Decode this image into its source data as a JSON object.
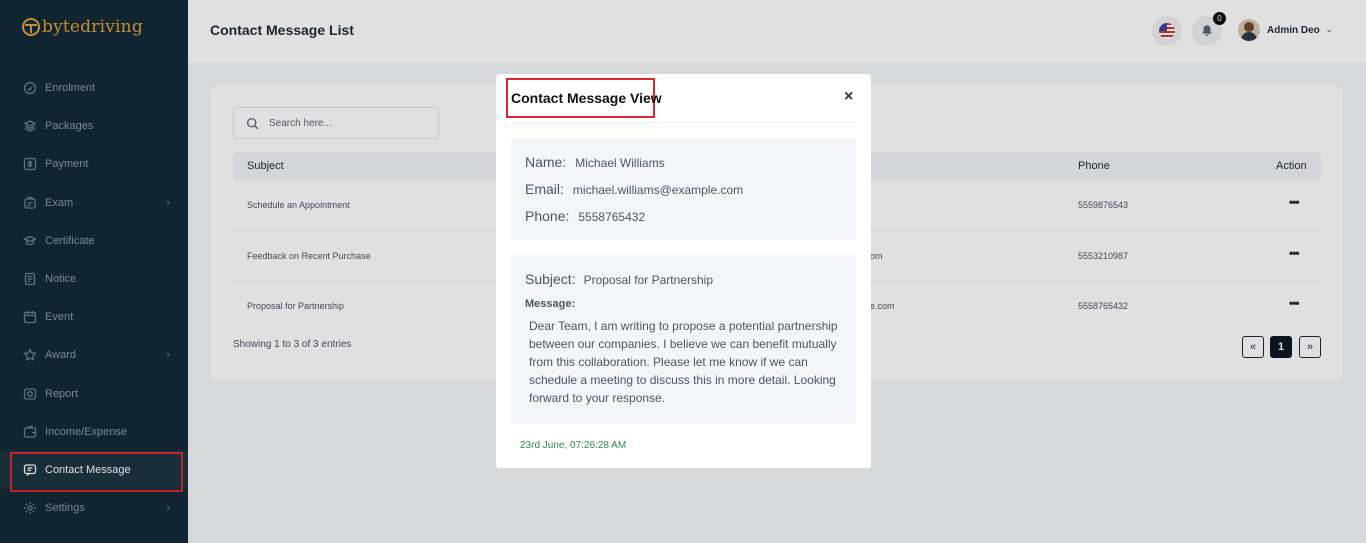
{
  "app": {
    "logo": "bytedriving"
  },
  "sidebar": {
    "items": [
      {
        "label": "Enrolment",
        "icon": "enrolment-icon",
        "chevron": false
      },
      {
        "label": "Packages",
        "icon": "packages-icon",
        "chevron": false
      },
      {
        "label": "Payment",
        "icon": "payment-icon",
        "chevron": false
      },
      {
        "label": "Exam",
        "icon": "exam-icon",
        "chevron": true
      },
      {
        "label": "Certificate",
        "icon": "certificate-icon",
        "chevron": false
      },
      {
        "label": "Notice",
        "icon": "notice-icon",
        "chevron": false
      },
      {
        "label": "Event",
        "icon": "event-icon",
        "chevron": false
      },
      {
        "label": "Award",
        "icon": "award-icon",
        "chevron": true
      },
      {
        "label": "Report",
        "icon": "report-icon",
        "chevron": false
      },
      {
        "label": "Income/Expense",
        "icon": "wallet-icon",
        "chevron": false
      },
      {
        "label": "Contact Message",
        "icon": "message-icon",
        "chevron": false,
        "active": true
      },
      {
        "label": "Settings",
        "icon": "settings-icon",
        "chevron": true
      }
    ]
  },
  "header": {
    "title": "Contact Message List",
    "notification_count": "0",
    "user_name": "Admin Deo"
  },
  "search": {
    "placeholder": "Search here..."
  },
  "table": {
    "columns": {
      "subject": "Subject",
      "phone": "Phone",
      "action": "Action"
    },
    "rows": [
      {
        "subject": "Schedule an Appointment",
        "email_tail": "",
        "phone": "5559876543"
      },
      {
        "subject": "Feedback on Recent Purchase",
        "email_tail": "om",
        "phone": "5553210987"
      },
      {
        "subject": "Proposal for Partnership",
        "email_tail": "e.com",
        "phone": "5558765432"
      }
    ],
    "showing": "Showing 1 to 3 of 3 entries",
    "pagination": {
      "prev": "«",
      "current": "1",
      "next": "»"
    }
  },
  "modal": {
    "title": "Contact Message View",
    "close": "×",
    "name_label": "Name:",
    "name": "Michael Williams",
    "email_label": "Email:",
    "email": "michael.williams@example.com",
    "phone_label": "Phone:",
    "phone": "5558765432",
    "subject_label": "Subject:",
    "subject": "Proposal for Partnership",
    "message_label": "Message:",
    "message": "Dear Team, I am writing to propose a potential partnership between our companies. I believe we can benefit mutually from this collaboration. Please let me know if we can schedule a meeting to discuss this in more detail. Looking forward to your response.",
    "date": "23rd June, 07:26:28 AM"
  },
  "colors": {
    "sidebar_bg": "#142a38",
    "brand": "#e2a13c",
    "highlight": "#e0272d",
    "date": "#2f8a4a"
  }
}
